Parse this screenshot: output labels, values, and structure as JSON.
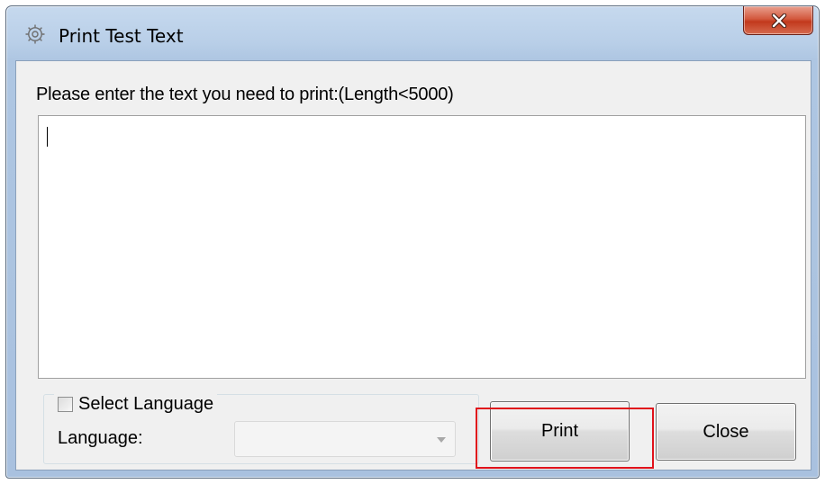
{
  "window": {
    "title": "Print Test Text",
    "title_icon": "gear-icon",
    "close_icon": "close-icon"
  },
  "form": {
    "prompt_label": "Please enter the text you need to print:(Length<5000)",
    "text_value": "",
    "select_language_label": "Select Language",
    "select_language_checked": false,
    "language_label": "Language:",
    "language_value": "",
    "language_options": []
  },
  "buttons": {
    "print_label": "Print",
    "close_label": "Close"
  },
  "colors": {
    "titlebar": "#b9cfe8",
    "close_button": "#c2391d",
    "highlight": "#e0121b",
    "client_bg": "#f0f0f0"
  }
}
